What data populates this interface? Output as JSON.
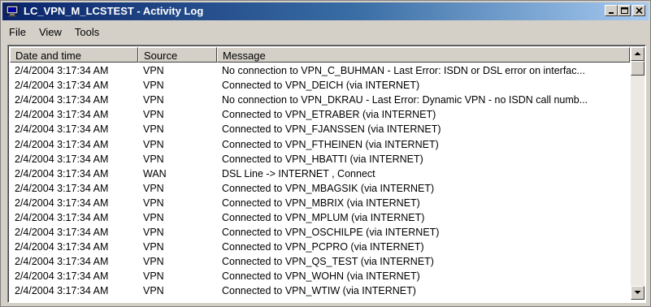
{
  "window": {
    "title": "LC_VPN_M_LCSTEST - Activity Log"
  },
  "menu": [
    "File",
    "View",
    "Tools"
  ],
  "columns": [
    "Date and time",
    "Source",
    "Message"
  ],
  "rows": [
    [
      "2/4/2004 3:17:34 AM",
      "VPN",
      "No connection to VPN_C_BUHMAN  - Last Error:  ISDN or DSL error on interfac..."
    ],
    [
      "2/4/2004 3:17:34 AM",
      "VPN",
      "Connected to VPN_DEICH (via INTERNET)"
    ],
    [
      "2/4/2004 3:17:34 AM",
      "VPN",
      "No connection to VPN_DKRAU  - Last Error:  Dynamic VPN - no ISDN call numb..."
    ],
    [
      "2/4/2004 3:17:34 AM",
      "VPN",
      "Connected to VPN_ETRABER (via INTERNET)"
    ],
    [
      "2/4/2004 3:17:34 AM",
      "VPN",
      "Connected to VPN_FJANSSEN (via INTERNET)"
    ],
    [
      "2/4/2004 3:17:34 AM",
      "VPN",
      "Connected to VPN_FTHEINEN (via INTERNET)"
    ],
    [
      "2/4/2004 3:17:34 AM",
      "VPN",
      "Connected to VPN_HBATTI (via INTERNET)"
    ],
    [
      "2/4/2004 3:17:34 AM",
      "WAN",
      "DSL Line -> INTERNET , Connect"
    ],
    [
      "2/4/2004 3:17:34 AM",
      "VPN",
      "Connected to VPN_MBAGSIK (via INTERNET)"
    ],
    [
      "2/4/2004 3:17:34 AM",
      "VPN",
      "Connected to VPN_MBRIX (via INTERNET)"
    ],
    [
      "2/4/2004 3:17:34 AM",
      "VPN",
      "Connected to VPN_MPLUM (via INTERNET)"
    ],
    [
      "2/4/2004 3:17:34 AM",
      "VPN",
      "Connected to VPN_OSCHILPE (via INTERNET)"
    ],
    [
      "2/4/2004 3:17:34 AM",
      "VPN",
      "Connected to VPN_PCPRO (via INTERNET)"
    ],
    [
      "2/4/2004 3:17:34 AM",
      "VPN",
      "Connected to VPN_QS_TEST (via INTERNET)"
    ],
    [
      "2/4/2004 3:17:34 AM",
      "VPN",
      "Connected to VPN_WOHN (via INTERNET)"
    ],
    [
      "2/4/2004 3:17:34 AM",
      "VPN",
      "Connected to VPN_WTIW (via INTERNET)"
    ]
  ]
}
